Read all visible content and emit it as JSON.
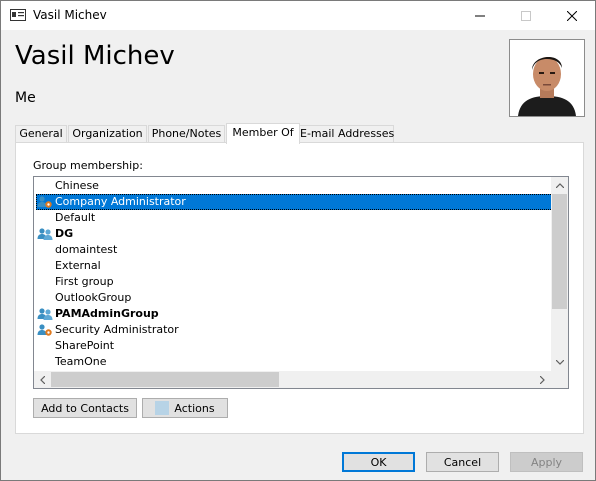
{
  "window": {
    "title": "Vasil Michev",
    "controls": {
      "minimize": "minimize",
      "maximize": "maximize",
      "close": "close"
    }
  },
  "header": {
    "name": "Vasil Michev",
    "subtitle": "Me"
  },
  "tabs": [
    {
      "label": "General",
      "active": false
    },
    {
      "label": "Organization",
      "active": false
    },
    {
      "label": "Phone/Notes",
      "active": false
    },
    {
      "label": "Member Of",
      "active": true
    },
    {
      "label": "E-mail Addresses",
      "active": false
    }
  ],
  "membership": {
    "label": "Group membership:",
    "groups": [
      {
        "name": "Chinese",
        "icon": "",
        "bold": false,
        "selected": false
      },
      {
        "name": "Company Administrator",
        "icon": "admin-role-icon",
        "bold": false,
        "selected": true
      },
      {
        "name": "Default",
        "icon": "",
        "bold": false,
        "selected": false
      },
      {
        "name": "DG",
        "icon": "group-icon",
        "bold": true,
        "selected": false
      },
      {
        "name": "domaintest",
        "icon": "",
        "bold": false,
        "selected": false
      },
      {
        "name": "External",
        "icon": "",
        "bold": false,
        "selected": false
      },
      {
        "name": "First group",
        "icon": "",
        "bold": false,
        "selected": false
      },
      {
        "name": "OutlookGroup",
        "icon": "",
        "bold": false,
        "selected": false
      },
      {
        "name": "PAMAdminGroup",
        "icon": "group-icon",
        "bold": true,
        "selected": false
      },
      {
        "name": "Security Administrator",
        "icon": "admin-role-icon",
        "bold": false,
        "selected": false
      },
      {
        "name": "SharePoint",
        "icon": "",
        "bold": false,
        "selected": false
      },
      {
        "name": "TeamOne",
        "icon": "",
        "bold": false,
        "selected": false
      }
    ]
  },
  "buttons": {
    "add_to_contacts": "Add to Contacts",
    "actions": "Actions",
    "ok": "OK",
    "cancel": "Cancel",
    "apply": "Apply"
  },
  "colors": {
    "selection": "#0078d7",
    "group_icon": "#3a8fc2",
    "admin_gear": "#e07a1f"
  }
}
